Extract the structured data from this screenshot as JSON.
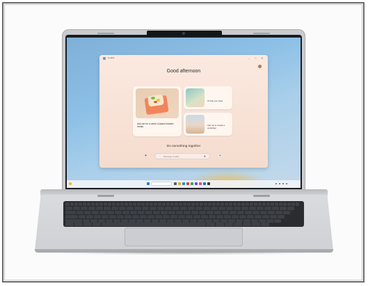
{
  "app": {
    "title": "Copilot",
    "greeting": "Good afternoon",
    "cards": [
      {
        "label": "Ask me for a week of plant-forward meals"
      },
      {
        "label": "I'll help you relax"
      },
      {
        "label": "Ask me to create a workshop"
      }
    ],
    "section_title": "Do something together",
    "composer": {
      "placeholder": "Message Copilot"
    },
    "window_controls": [
      "–",
      "□",
      "✕"
    ]
  },
  "taskbar": {
    "clock": {
      "time": "",
      "date": ""
    }
  },
  "colors": {
    "wallpaper": "#8dc0e6",
    "app_background": "#f8e2d6",
    "laptop_body": "#cfd1d4",
    "keyboard": "#2a2c30"
  },
  "icons": {
    "composer_left": "sparkle-icon",
    "composer_mic": "microphone-icon",
    "composer_send": "add-icon"
  }
}
